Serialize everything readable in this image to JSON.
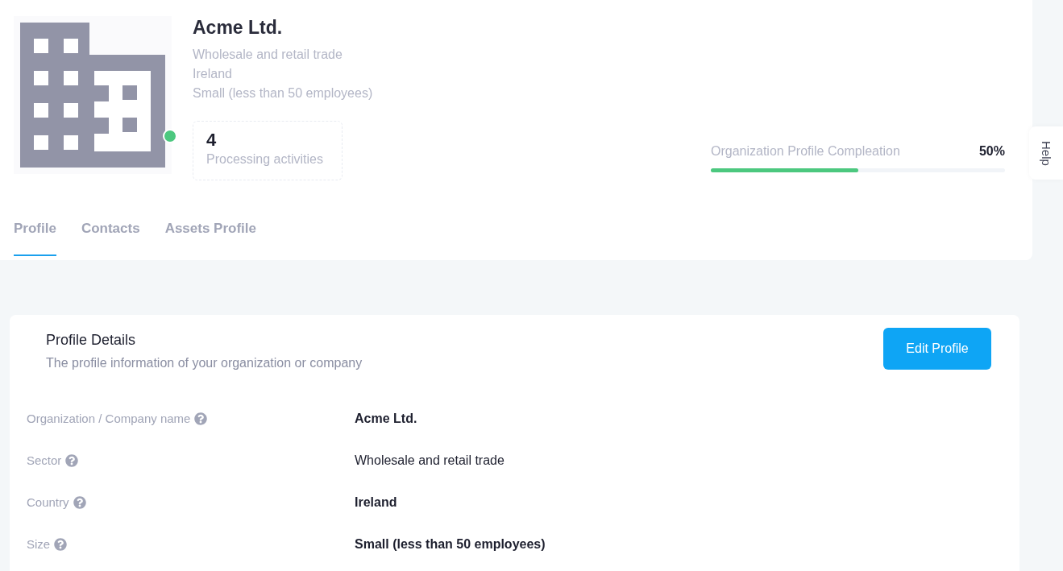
{
  "organization": {
    "name": "Acme Ltd.",
    "sector": "Wholesale and retail trade",
    "country": "Ireland",
    "size": "Small (less than 50 employees)",
    "online": true
  },
  "stat": {
    "value": "4",
    "label": "Processing activities"
  },
  "completion": {
    "label": "Organization Profile Compleation",
    "reading": "50%",
    "level": 0.5
  },
  "tabs": [
    {
      "label": "Profile",
      "selected": true
    },
    {
      "label": "Contacts",
      "selected": false
    },
    {
      "label": "Assets Profile",
      "selected": false
    }
  ],
  "help": {
    "label": "Help"
  },
  "details": {
    "title": "Profile Details",
    "subtitle": "The profile information of your organization or company",
    "button": "Edit Profile",
    "fields": [
      {
        "label": "Organization / Company name",
        "value": "Acme Ltd.",
        "bold": true
      },
      {
        "label": "Sector",
        "value": "Wholesale and retail trade",
        "bold": false
      },
      {
        "label": "Country",
        "value": "Ireland",
        "bold": true
      },
      {
        "label": "Size",
        "value": "Small (less than 50 employees)",
        "bold": true
      }
    ]
  }
}
